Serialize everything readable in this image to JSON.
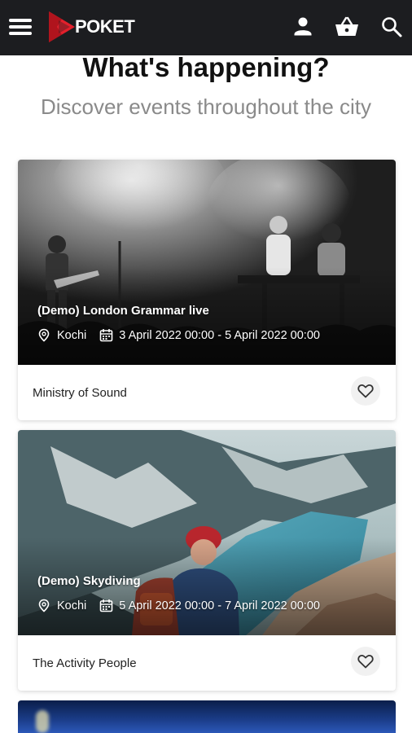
{
  "brand": {
    "name": "POKET",
    "accent": "#e2202c"
  },
  "header": {
    "icons": [
      "menu-icon",
      "user-icon",
      "basket-icon",
      "search-icon"
    ]
  },
  "hero": {
    "title": "What's happening?",
    "subtitle": "Discover events throughout the city"
  },
  "events": [
    {
      "title": "(Demo) London Grammar live",
      "location": "Kochi",
      "dates": "3 April 2022 00:00 - 5 April 2022 00:00",
      "organizer": "Ministry of Sound",
      "image": "concert-photo"
    },
    {
      "title": "(Demo) Skydiving",
      "location": "Kochi",
      "dates": "5 April 2022 00:00 - 7 April 2022 00:00",
      "organizer": "The Activity People",
      "image": "mountain-lake-photo"
    }
  ]
}
